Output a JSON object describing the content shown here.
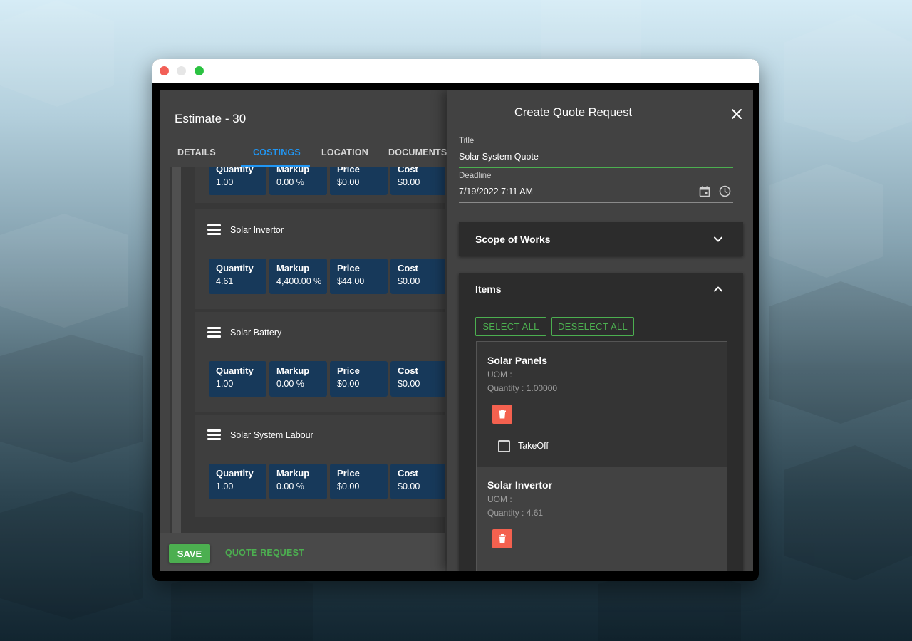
{
  "estimate": {
    "title": "Estimate - 30",
    "tabs": [
      {
        "label": "DETAILS"
      },
      {
        "label": "COSTINGS"
      },
      {
        "label": "LOCATION"
      },
      {
        "label": "DOCUMENTS"
      }
    ],
    "cost_items": [
      {
        "name": "",
        "quantity": "1.00",
        "markup": "0.00 %",
        "price": "$0.00",
        "cost": "$0.00"
      },
      {
        "name": "Solar Invertor",
        "quantity": "4.61",
        "markup": "4,400.00 %",
        "price": "$44.00",
        "cost": "$0.00"
      },
      {
        "name": "Solar Battery",
        "quantity": "1.00",
        "markup": "0.00 %",
        "price": "$0.00",
        "cost": "$0.00"
      },
      {
        "name": "Solar System Labour",
        "quantity": "1.00",
        "markup": "0.00 %",
        "price": "$0.00",
        "cost": "$0.00"
      }
    ],
    "card_labels": {
      "quantity": "Quantity",
      "markup": "Markup",
      "price": "Price",
      "cost": "Cost"
    },
    "footer": {
      "save_label": "SAVE",
      "quote_label": "QUOTE REQUEST"
    }
  },
  "drawer": {
    "title": "Create Quote Request",
    "title_field": {
      "label": "Title",
      "value": "Solar System Quote"
    },
    "deadline_field": {
      "label": "Deadline",
      "value": "7/19/2022 7:11 AM"
    },
    "scope_panel": {
      "title": "Scope of Works"
    },
    "items_panel": {
      "title": "Items",
      "select_all": "SELECT ALL",
      "deselect_all": "DESELECT ALL",
      "items": [
        {
          "name": "Solar Panels",
          "uom": "UOM :",
          "quantity": "Quantity : 1.00000",
          "takeoff_label": "TakeOff"
        },
        {
          "name": "Solar Invertor",
          "uom": "UOM :",
          "quantity": "Quantity : 4.61"
        }
      ]
    }
  },
  "colors": {
    "accent_blue": "#2196f3",
    "accent_green": "#4caf50",
    "card_blue": "#17395a",
    "delete_red": "#f4614f"
  }
}
